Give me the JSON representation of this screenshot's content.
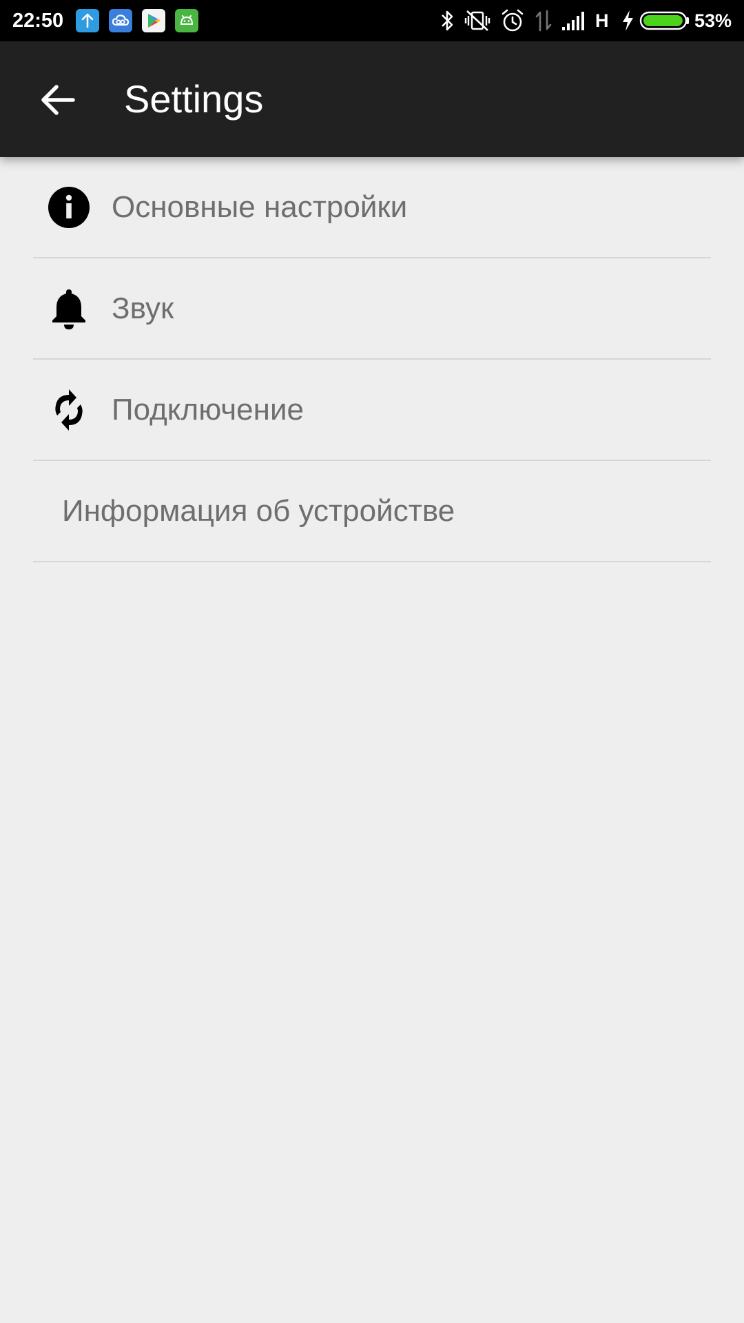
{
  "status_bar": {
    "time": "22:50",
    "network_type": "H",
    "battery_percent": "53%",
    "battery_level": 0.53,
    "notification_icons": [
      "upload-icon",
      "cloud-icon",
      "play-store-icon",
      "android-app-icon"
    ],
    "system_icons": [
      "bluetooth-icon",
      "vibrate-off-icon",
      "alarm-icon",
      "data-arrows-icon",
      "signal-icon",
      "charging-icon",
      "battery-icon"
    ]
  },
  "app_bar": {
    "title": "Settings",
    "back_icon": "arrow-back-icon"
  },
  "settings_items": [
    {
      "label": "Основные настройки",
      "icon": "info-icon"
    },
    {
      "label": "Звук",
      "icon": "bell-icon"
    },
    {
      "label": "Подключение",
      "icon": "sync-icon"
    },
    {
      "label": "Информация об устройстве",
      "icon": ""
    }
  ],
  "colors": {
    "app_bar_bg": "#212121",
    "status_bar_bg": "#000000",
    "page_bg": "#eeeeef",
    "item_text": "#6e6e6e",
    "divider": "#d6d6d6",
    "battery_fill": "#4cd41c"
  }
}
